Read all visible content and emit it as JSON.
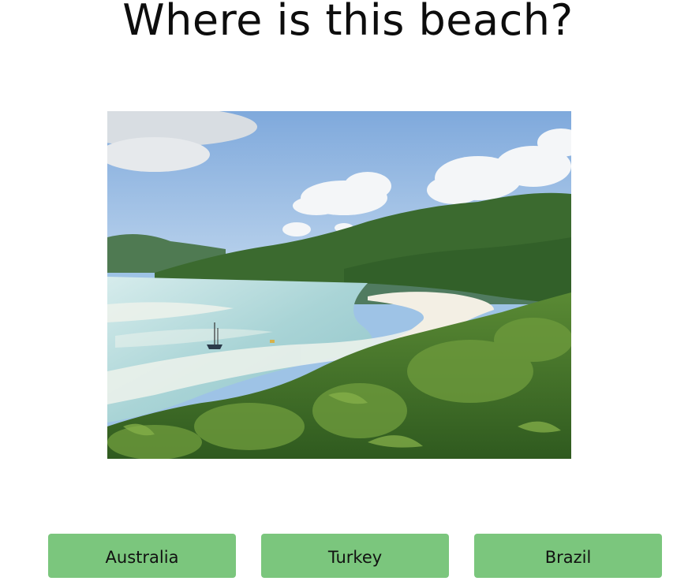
{
  "quiz": {
    "question": "Where is this beach?",
    "image_subject": "beach-photo",
    "answers": [
      {
        "label": "Australia"
      },
      {
        "label": "Turkey"
      },
      {
        "label": "Brazil"
      }
    ]
  },
  "theme": {
    "button_color": "#7bc67d",
    "background": "#ffffff",
    "text_color": "#111111"
  }
}
